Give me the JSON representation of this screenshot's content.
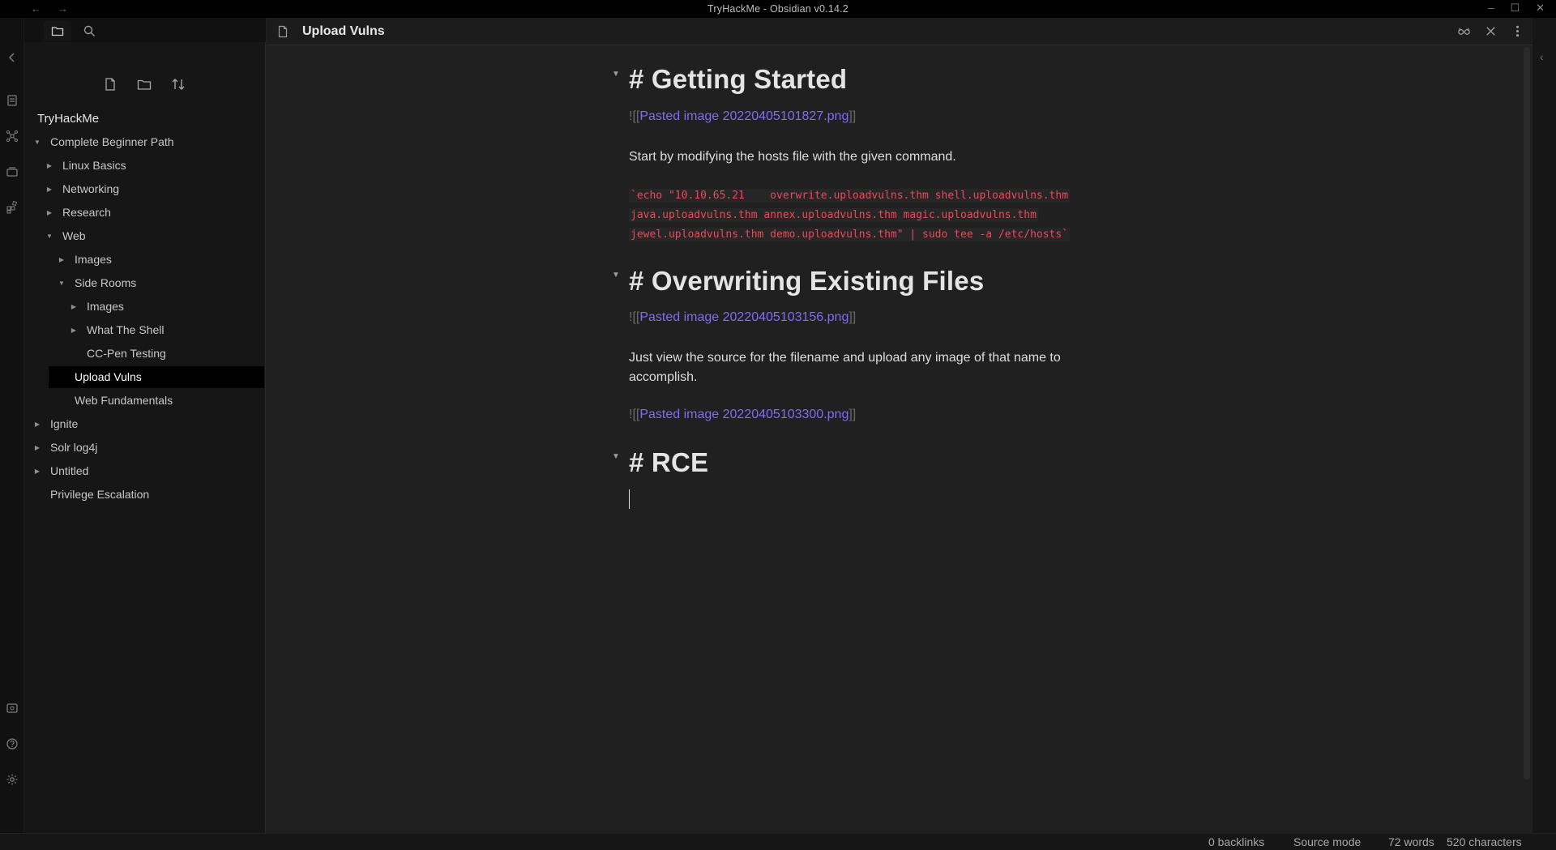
{
  "window": {
    "title": "TryHackMe - Obsidian v0.14.2",
    "back": "←",
    "forward": "→",
    "minimize": "–",
    "maximize": "☐",
    "close": "✕"
  },
  "sidebar": {
    "vault_name": "TryHackMe",
    "tree": [
      {
        "label": "Complete Beginner Path",
        "arrow": "▼"
      },
      {
        "label": "Linux Basics",
        "arrow": "▶"
      },
      {
        "label": "Networking",
        "arrow": "▶"
      },
      {
        "label": "Research",
        "arrow": "▶"
      },
      {
        "label": "Web",
        "arrow": "▼"
      },
      {
        "label": "Images",
        "arrow": "▶"
      },
      {
        "label": "Side Rooms",
        "arrow": "▼"
      },
      {
        "label": "Images",
        "arrow": "▶"
      },
      {
        "label": "What The Shell",
        "arrow": "▶"
      },
      {
        "label": "CC-Pen Testing",
        "arrow": ""
      },
      {
        "label": "Upload Vulns",
        "arrow": ""
      },
      {
        "label": "Web Fundamentals",
        "arrow": ""
      },
      {
        "label": "Ignite",
        "arrow": "▶"
      },
      {
        "label": "Solr log4j",
        "arrow": "▶"
      },
      {
        "label": "Untitled",
        "arrow": "▶"
      },
      {
        "label": "Privilege Escalation",
        "arrow": ""
      }
    ]
  },
  "editor": {
    "file_title": "Upload Vulns",
    "sections": {
      "h1": "# Getting Started",
      "img1_prefix": "![[",
      "img1_link": "Pasted image 20220405101827.png",
      "img1_suffix": "]]",
      "p1": "Start by modifying the hosts file with the given command.",
      "code1": "`echo \"10.10.65.21    overwrite.uploadvulns.thm shell.uploadvulns.thm",
      "code2": "java.uploadvulns.thm annex.uploadvulns.thm magic.uploadvulns.thm",
      "code3": "jewel.uploadvulns.thm demo.uploadvulns.thm\" | sudo tee -a /etc/hosts`",
      "h2": "# Overwriting Existing Files",
      "img2_prefix": "![[",
      "img2_link": "Pasted image 20220405103156.png",
      "img2_suffix": "]]",
      "p2": "Just view the source for the filename and upload any image of that name to accomplish.",
      "img3_prefix": "![[",
      "img3_link": "Pasted image 20220405103300.png",
      "img3_suffix": "]]",
      "h3": "# RCE"
    },
    "fold_arrow": "▼"
  },
  "status": {
    "backlinks": "0 backlinks",
    "mode": "Source mode",
    "words": "72 words",
    "chars": "520 characters"
  },
  "right_edge": {
    "chevron": "‹"
  },
  "colors": {
    "accent": "#7f6df2",
    "code": "#e94b5a",
    "background": "#202020",
    "sidebar": "#161616"
  }
}
